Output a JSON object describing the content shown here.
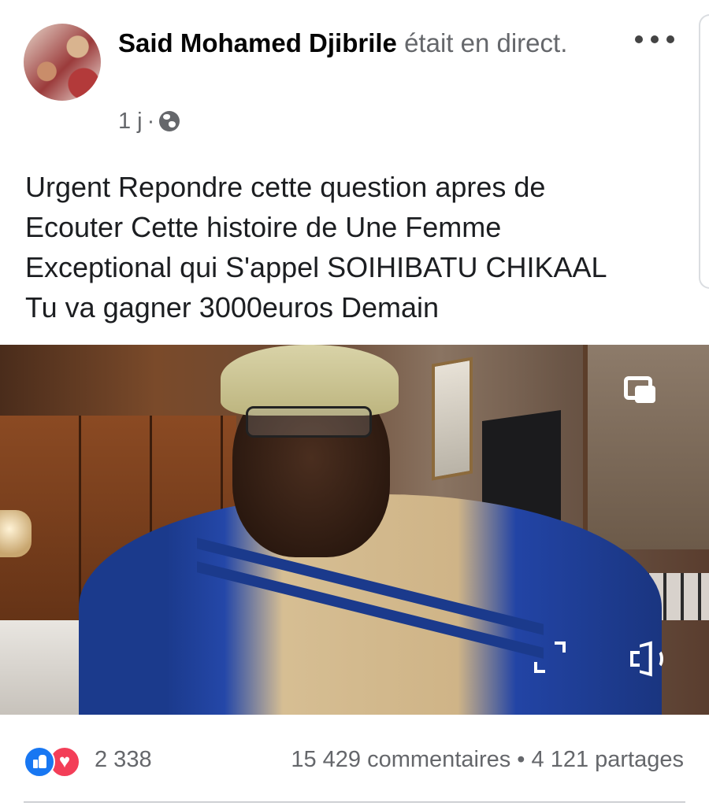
{
  "post": {
    "author_name": "Said Mohamed Djibrile",
    "status_text": "était en direct.",
    "time": "1 j",
    "separator": "·",
    "privacy_icon": "globe-icon",
    "text": "Urgent Repondre cette question apres de\nEcouter Cette histoire de Une Femme\nExceptional qui S'appel SOIHIBATU CHIKAAL\nTu va gagner 3000euros Demain"
  },
  "video": {
    "controls": [
      "picture-in-picture-icon",
      "fullscreen-icon",
      "volume-icon"
    ]
  },
  "stats": {
    "reaction_count": "2 338",
    "reaction_icons": [
      "like-icon",
      "love-icon"
    ],
    "comments": "15 429 commentaires",
    "dot": "•",
    "shares": "4 121 partages"
  },
  "colors": {
    "text": "#1c1e21",
    "secondary": "#65676b",
    "like_blue": "#1877f2",
    "love_red": "#f33e58"
  }
}
